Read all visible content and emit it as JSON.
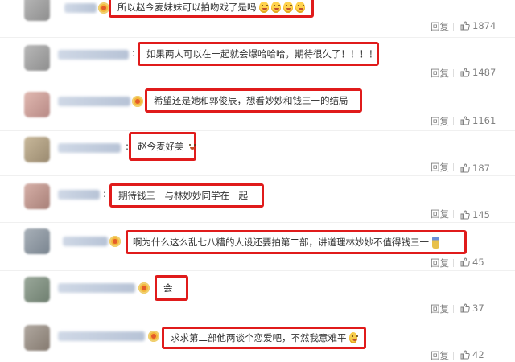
{
  "actions": {
    "reply_label": "回复"
  },
  "comments": [
    {
      "text": "所以赵今麦妹妹可以拍吻戏了是吗",
      "emoji": [
        "laugh-emoji",
        "laugh-emoji",
        "laugh-emoji",
        "laugh-emoji"
      ],
      "likes": "1874"
    },
    {
      "text": "如果两人可以在一起就会爆哈哈哈，期待很久了！！！！",
      "emoji": [],
      "likes": "1487"
    },
    {
      "text": "希望还是她和郭俊辰，想看妙妙和钱三一的结局",
      "emoji": [],
      "likes": "1161"
    },
    {
      "text": "赵今麦好美",
      "emoji": [
        "grin-emoji"
      ],
      "likes": "187"
    },
    {
      "text": "期待钱三一与林妙妙同学在一起",
      "emoji": [],
      "likes": "145"
    },
    {
      "text": "啊为什么这么乱七八糟的人设还要拍第二部，讲道理林妙妙不值得钱三一",
      "emoji": [
        "bottle-emoji"
      ],
      "likes": "45"
    },
    {
      "text": "会",
      "emoji": [],
      "likes": "37"
    },
    {
      "text": "求求第二部他两谈个恋爱吧，不然我意难平",
      "emoji": [
        "sad-emoji"
      ],
      "likes": "42"
    }
  ],
  "colors": {
    "highlight_border": "#e01b1b",
    "meta_text": "#808080"
  }
}
